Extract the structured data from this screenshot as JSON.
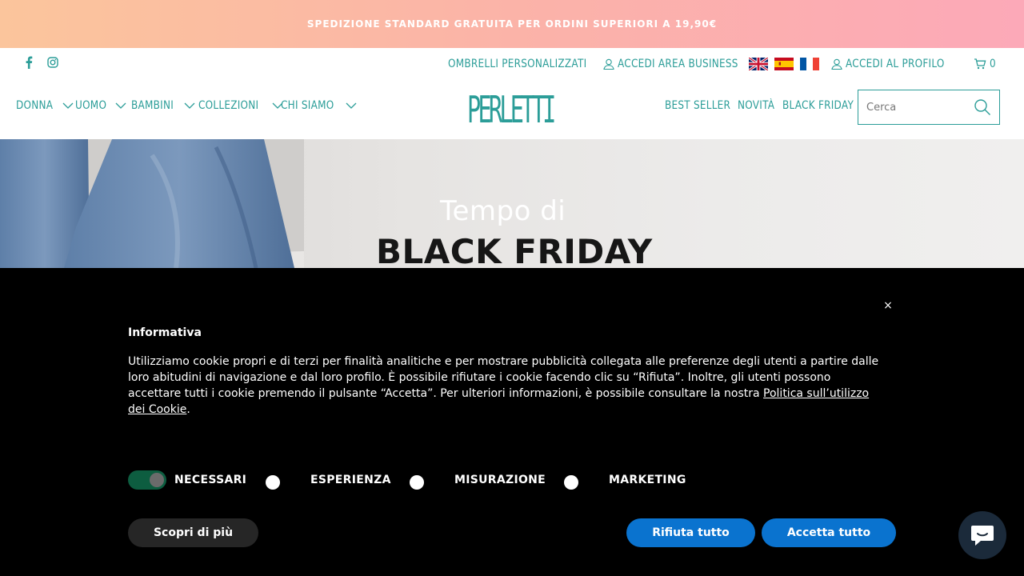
{
  "announcement": {
    "text": "SPEDIZIONE STANDARD GRATUITA PER ORDINI SUPERIORI A 19,90€"
  },
  "header": {
    "social": [
      {
        "icon": "facebook-icon"
      },
      {
        "icon": "instagram-icon"
      }
    ],
    "top_links": {
      "custom_umbrellas": "OMBRELLI PERSONALIZZATI",
      "business_login": "ACCEDI AREA BUSINESS",
      "profile_login": "ACCEDI AL PROFILO",
      "cart_count": "0"
    },
    "languages": [
      {
        "icon": "flag-uk-icon"
      },
      {
        "icon": "flag-es-icon"
      },
      {
        "icon": "flag-fr-icon"
      }
    ],
    "logo": "PERLETTI",
    "main_nav": [
      {
        "label": "DONNA"
      },
      {
        "label": "UOMO"
      },
      {
        "label": "BAMBINI"
      },
      {
        "label": "COLLEZIONI"
      },
      {
        "label": "CHI SIAMO"
      }
    ],
    "right_nav": [
      {
        "label": "BEST SELLER"
      },
      {
        "label": "NOVITÀ"
      },
      {
        "label": "BLACK FRIDAY"
      }
    ],
    "search": {
      "placeholder": "Cerca",
      "value": ""
    },
    "accent_color": "#2b9d98"
  },
  "hero": {
    "subtitle": "Tempo di",
    "title": "BLACK FRIDAY"
  },
  "cookie_banner": {
    "title": "Informativa",
    "text_before_link": "Utilizziamo cookie propri e di terzi per finalità analitiche e per mostrare pubblicità collegata alle preferenze degli utenti a partire dalle loro abitudini di navigazione e dal loro profilo. È possibile rifiutare i cookie facendo clic su “Rifiuta”. Inoltre, gli utenti possono accettare tutti i cookie premendo il pulsante “Accetta”. Per ulteriori informazioni, è possibile consultare la nostra ",
    "link_text": "Politica sull’utilizzo dei Cookie",
    "text_after_link": ".",
    "options": {
      "necessary": "NECESSARI",
      "experience": "ESPERIENZA",
      "measurement": "MISURAZIONE",
      "marketing": "MARKETING"
    },
    "buttons": {
      "more": "Scopri di più",
      "reject": "Rifiuta tutto",
      "accept": "Accetta tutto"
    },
    "close_symbol": "×",
    "button_color": "#0a73cf"
  }
}
